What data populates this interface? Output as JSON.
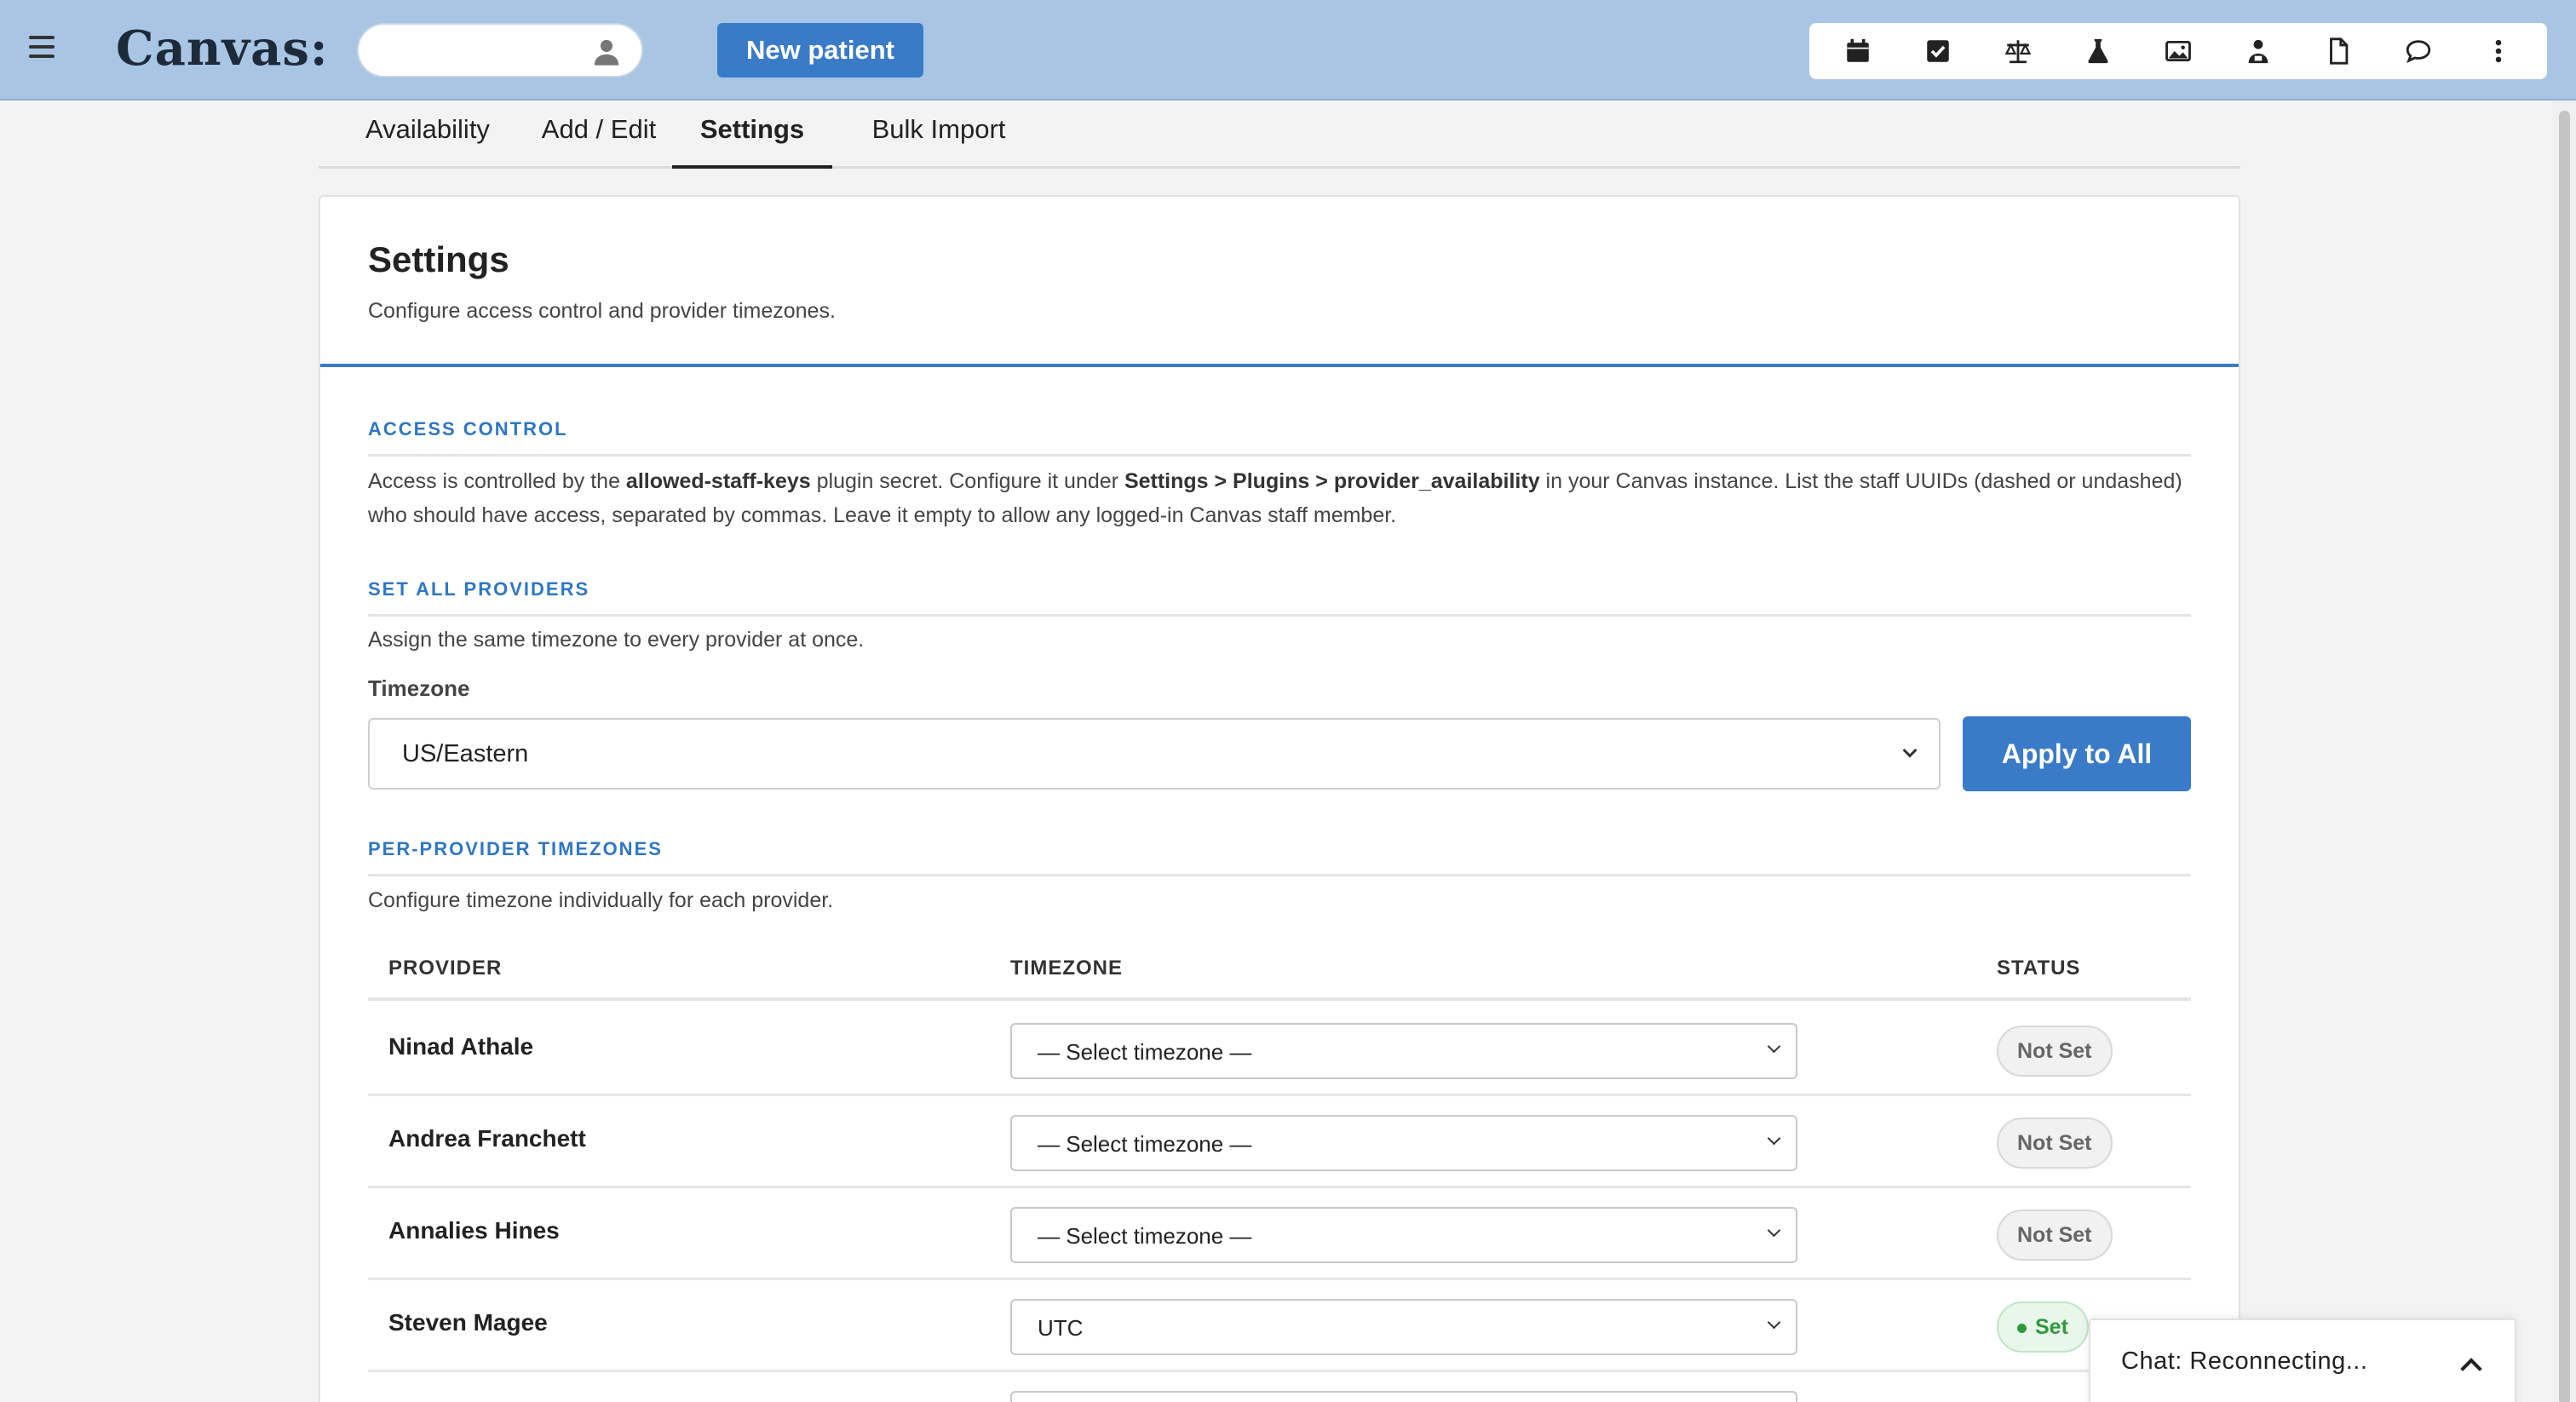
{
  "app": {
    "logo_text": "Canvas:"
  },
  "header": {
    "search_placeholder": "",
    "new_patient_label": "New patient",
    "toolbar_icons": [
      "calendar-icon",
      "checkbox-icon",
      "scale-icon",
      "flask-icon",
      "image-icon",
      "user-group-icon",
      "document-icon",
      "chat-bubble-icon",
      "more-vertical-icon"
    ]
  },
  "tabs": [
    {
      "label": "Availability",
      "active": false
    },
    {
      "label": "Add / Edit",
      "active": false
    },
    {
      "label": "Settings",
      "active": true
    },
    {
      "label": "Bulk Import",
      "active": false
    }
  ],
  "settings": {
    "title": "Settings",
    "subtitle": "Configure access control and provider timezones.",
    "access_control": {
      "heading": "ACCESS CONTROL",
      "text_1": "Access is controlled by the ",
      "key_name": "allowed-staff-keys",
      "text_2": " plugin secret. Configure it under ",
      "path": "Settings > Plugins > provider_availability",
      "text_3": " in your Canvas instance. List the staff UUIDs (dashed or undashed) who should have access, separated by commas. Leave it empty to allow any logged-in Canvas staff member."
    },
    "set_all": {
      "heading": "SET ALL PROVIDERS",
      "description": "Assign the same timezone to every provider at once.",
      "timezone_label": "Timezone",
      "timezone_value": "US/Eastern",
      "apply_label": "Apply to All"
    },
    "per_provider": {
      "heading": "PER-PROVIDER TIMEZONES",
      "description": "Configure timezone individually for each provider.",
      "columns": [
        "PROVIDER",
        "TIMEZONE",
        "STATUS"
      ],
      "rows": [
        {
          "provider": "Ninad Athale",
          "timezone": "— Select timezone —",
          "status": "Not Set",
          "is_set": false
        },
        {
          "provider": "Andrea Franchett",
          "timezone": "— Select timezone —",
          "status": "Not Set",
          "is_set": false
        },
        {
          "provider": "Annalies Hines",
          "timezone": "— Select timezone —",
          "status": "Not Set",
          "is_set": false
        },
        {
          "provider": "Steven Magee",
          "timezone": "UTC",
          "status": "Set",
          "is_set": true
        }
      ]
    }
  },
  "chat": {
    "label": "Chat: Reconnecting..."
  },
  "colors": {
    "accent": "#3a7bc8",
    "header_bg": "#a9c5e4",
    "set_green": "#2f9a3e"
  }
}
